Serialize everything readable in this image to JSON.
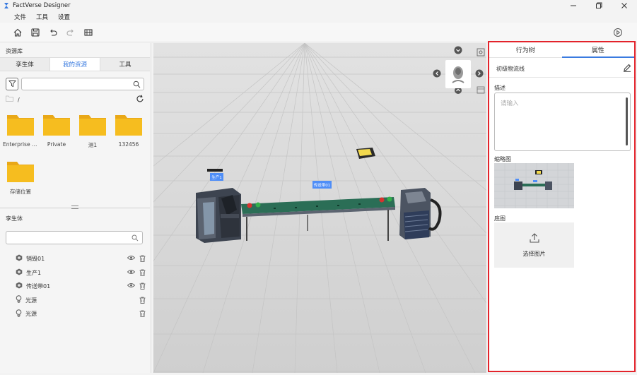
{
  "window": {
    "title": "FactVerse Designer",
    "icons": [
      "app-logo-icon",
      "minimize-icon",
      "restore-icon",
      "close-icon"
    ]
  },
  "menu": {
    "items": [
      "文件",
      "工具",
      "设置"
    ]
  },
  "toolbar": {
    "icons": [
      "home-icon",
      "save-icon",
      "undo-icon",
      "redo-icon",
      "map-icon",
      "play-icon"
    ]
  },
  "resource_panel": {
    "title": "资源库",
    "tabs": [
      "孪生体",
      "我的资源",
      "工具"
    ],
    "active_tab": "我的资源",
    "search": {
      "value": "",
      "placeholder": ""
    },
    "path": "/",
    "folders": [
      "Enterprise s...",
      "Private",
      "测1",
      "132456",
      "存储位置"
    ]
  },
  "scene_panel": {
    "title": "孪生体",
    "search": {
      "value": "",
      "placeholder": ""
    },
    "items": [
      {
        "label": "销毁01",
        "icon": "twin-icon",
        "visible_toggle": true
      },
      {
        "label": "生产1",
        "icon": "twin-icon",
        "visible_toggle": true
      },
      {
        "label": "传送带01",
        "icon": "twin-icon",
        "visible_toggle": true
      },
      {
        "label": "光源",
        "icon": "light-bulb-icon",
        "visible_toggle": false
      },
      {
        "label": "光源",
        "icon": "light-bulb-icon",
        "visible_toggle": false
      }
    ]
  },
  "viewport": {
    "labels": [
      "生产1",
      "传送带01"
    ]
  },
  "properties_panel": {
    "tabs": [
      "行为树",
      "属性"
    ],
    "active_tab": "属性",
    "name": "初级物流线",
    "description_label": "描述",
    "description": {
      "value": "",
      "placeholder": "请输入"
    },
    "thumbnail_label": "缩略图",
    "base_image_label": "底图",
    "upload_label": "选择图片"
  },
  "colors": {
    "accent": "#3a7be0",
    "highlight_border": "#e3232b",
    "folder": "#f6bd1f"
  }
}
